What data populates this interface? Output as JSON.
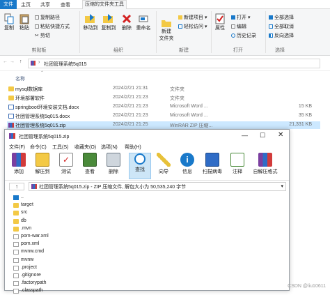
{
  "explorer": {
    "tabs": [
      {
        "label": "文件"
      },
      {
        "label": "主页"
      },
      {
        "label": "共享"
      },
      {
        "label": "查看"
      },
      {
        "label": "压缩的文件夹工具"
      }
    ],
    "ribbon": {
      "clipboard": {
        "copy": "复制",
        "paste": "粘贴",
        "copy_path": "复制路径",
        "paste_shortcut": "粘贴快捷方式",
        "cut": "剪切",
        "group": "剪贴板"
      },
      "organize": {
        "move_to": "移动到",
        "copy_to": "复制到",
        "delete": "删除",
        "rename": "重命名",
        "group": "组织"
      },
      "new": {
        "new_folder": "新建\n文件夹",
        "new_item": "新建项目",
        "easy_access": "轻松访问",
        "group": "新建"
      },
      "open": {
        "properties": "属性",
        "open": "打开",
        "edit": "编辑",
        "history": "历史记录",
        "group": "打开"
      },
      "select": {
        "select_all": "全部选择",
        "select_none": "全部取消",
        "invert": "反向选择",
        "group": "选择"
      }
    },
    "address": {
      "path": "社团管理系统5q015"
    },
    "columns": {
      "name": "名称",
      "date": "",
      "type": "",
      "size": ""
    },
    "files": [
      {
        "name": "mysql数据库",
        "date": "2024/2/21 21:31",
        "type": "文件夹",
        "size": "",
        "kind": "folder"
      },
      {
        "name": "环境部署软件",
        "date": "2024/2/21 21:23",
        "type": "文件夹",
        "size": "",
        "kind": "folder"
      },
      {
        "name": "springboot环境安装文档.docx",
        "date": "2024/2/21 21:23",
        "type": "Microsoft Word ...",
        "size": "15 KB",
        "kind": "doc"
      },
      {
        "name": "社团管理系统5q015.docx",
        "date": "2024/2/21 21:23",
        "type": "Microsoft Word ...",
        "size": "35 KB",
        "kind": "doc"
      },
      {
        "name": "社团管理系统5q015.zip",
        "date": "2024/2/21 21:25",
        "type": "WinRAR ZIP 压缩...",
        "size": "21,331 KB",
        "kind": "rar",
        "selected": true
      }
    ]
  },
  "winrar": {
    "title": "社团管理系统5q015.zip",
    "menu": [
      "文件(F)",
      "命令(C)",
      "工具(S)",
      "收藏夹(O)",
      "选项(N)",
      "帮助(H)"
    ],
    "tools": [
      "添加",
      "解压到",
      "测试",
      "查看",
      "删除",
      "查找",
      "向导",
      "信息",
      "扫描病毒",
      "注释",
      "自解压格式"
    ],
    "path": "社团管理系统5q015.zip - ZIP 压缩文件, 解包大小为 50,535,240 字节",
    "items": [
      {
        "name": "..",
        "kind": "up"
      },
      {
        "name": "target",
        "kind": "folder"
      },
      {
        "name": "src",
        "kind": "folder"
      },
      {
        "name": "db",
        "kind": "folder"
      },
      {
        "name": ".mvn",
        "kind": "folder"
      },
      {
        "name": "pom-war.xml",
        "kind": "file"
      },
      {
        "name": "pom.xml",
        "kind": "file"
      },
      {
        "name": "mvnw.cmd",
        "kind": "file"
      },
      {
        "name": "mvnw",
        "kind": "file"
      },
      {
        "name": ".project",
        "kind": "file"
      },
      {
        "name": ".gitignore",
        "kind": "file"
      },
      {
        "name": ".factorypath",
        "kind": "file"
      },
      {
        "name": ".classpath",
        "kind": "file"
      }
    ]
  },
  "watermark": "CSDN @liu10611",
  "colors": {
    "accent": "#1979ca",
    "selection": "#cce8ff",
    "folder": "#f3c945"
  }
}
